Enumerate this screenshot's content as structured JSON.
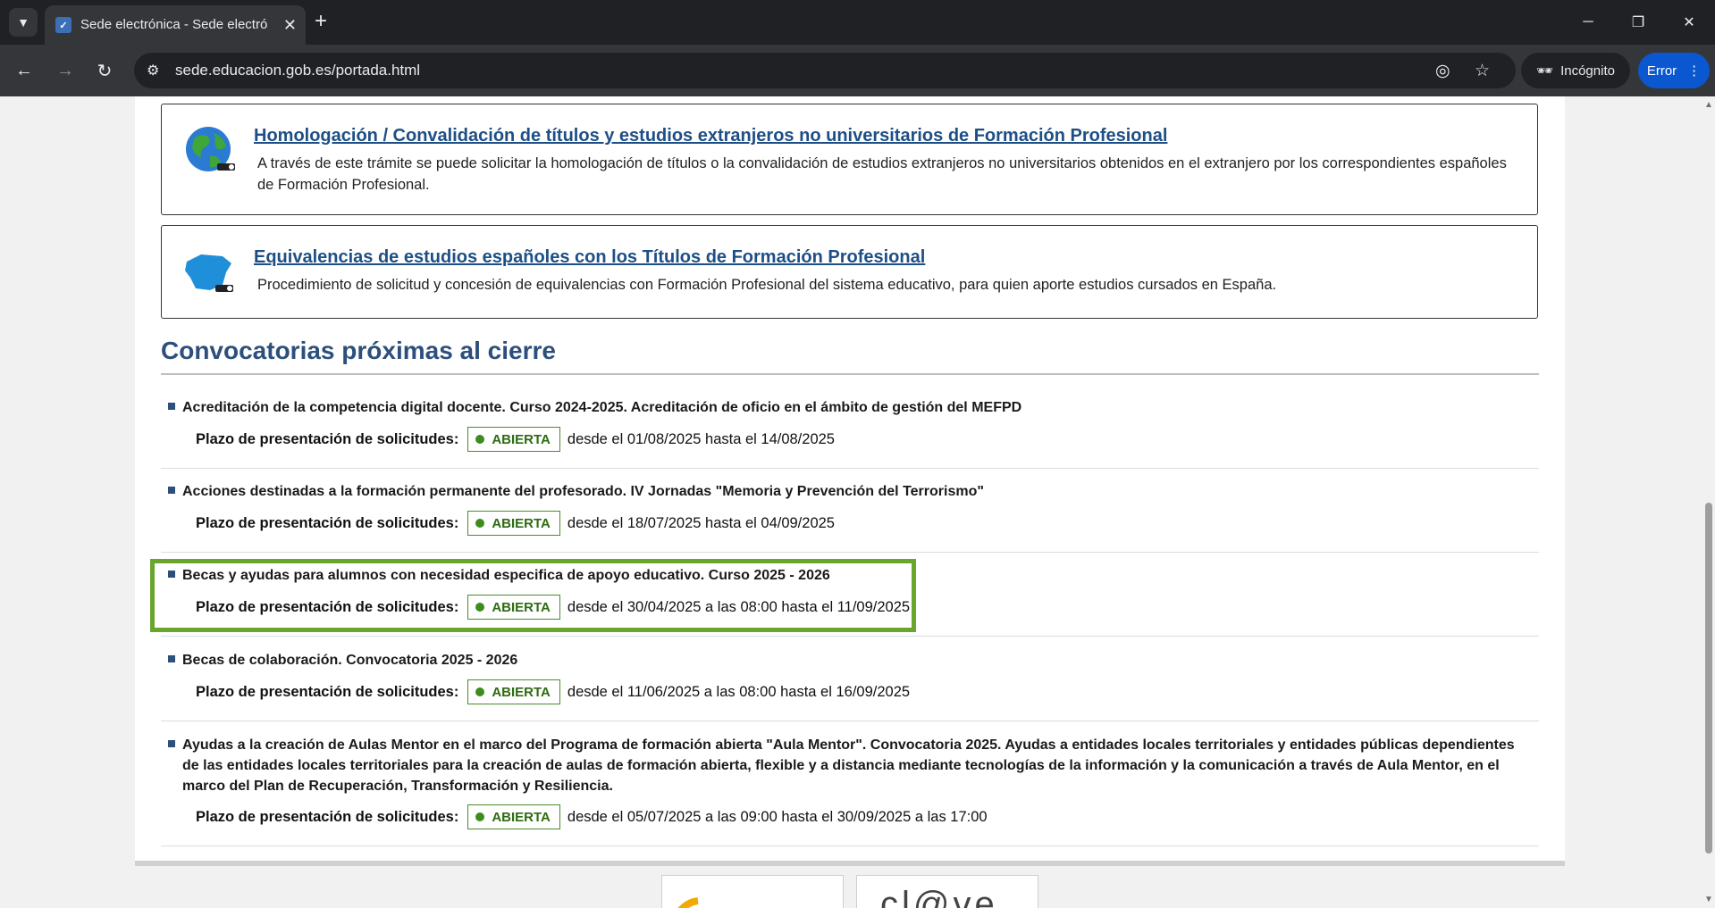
{
  "browser": {
    "tab_title": "Sede electrónica - Sede electrónica",
    "tab_close": "✕",
    "new_tab": "+",
    "url": "sede.educacion.gob.es/portada.html",
    "incognito_label": "Incógnito",
    "error_label": "Error"
  },
  "services": [
    {
      "title": "Homologación / Convalidación de títulos y estudios extranjeros no universitarios de Formación Profesional",
      "description": "A través de este trámite se puede solicitar la homologación de títulos o la convalidación de estudios extranjeros no universitarios obtenidos en el extranjero por los correspondientes españoles de Formación Profesional.",
      "icon": "globe-icon"
    },
    {
      "title": "Equivalencias de estudios españoles con los Títulos de Formación Profesional",
      "description": "Procedimiento de solicitud y concesión de equivalencias con Formación Profesional del sistema educativo, para quien aporte estudios cursados en España.",
      "icon": "spain-map-icon"
    }
  ],
  "section": {
    "title": "Convocatorias próximas al cierre"
  },
  "plazo_label": "Plazo de presentación de solicitudes:",
  "convocatorias": [
    {
      "title": "Acreditación de la competencia digital docente. Curso 2024-2025. Acreditación de oficio en el ámbito de gestión del MEFPD",
      "status": "ABIERTA",
      "dates": "desde el 01/08/2025 hasta el 14/08/2025"
    },
    {
      "title": "Acciones destinadas a la formación permanente del profesorado. IV Jornadas \"Memoria y Prevención del Terrorismo\"",
      "status": "ABIERTA",
      "dates": "desde el 18/07/2025 hasta el 04/09/2025"
    },
    {
      "title": "Becas y ayudas para alumnos con necesidad especifica de apoyo educativo. Curso 2025 - 2026",
      "status": "ABIERTA",
      "dates": "desde el 30/04/2025 a las 08:00 hasta el 11/09/2025"
    },
    {
      "title": "Becas de colaboración. Convocatoria 2025 - 2026",
      "status": "ABIERTA",
      "dates": "desde el 11/06/2025 a las 08:00 hasta el 16/09/2025"
    },
    {
      "title": "Ayudas a la creación de Aulas Mentor en el marco del Programa de formación abierta \"Aula Mentor\". Convocatoria 2025. Ayudas a entidades locales territoriales y entidades públicas dependientes de las entidades locales territoriales para la creación de aulas de formación abierta, flexible y a distancia mediante tecnologías de la información y la comunicación a través de Aula Mentor, en el marco del Plan de Recuperación, Transformación y Resiliencia.",
      "status": "ABIERTA",
      "dates": "desde el 05/07/2025 a las 09:00 hasta el 30/09/2025 a las 17:00"
    }
  ],
  "footer_logos": {
    "clave_text": "cl@ve"
  },
  "colors": {
    "link": "#1d4f86",
    "section_title": "#2c4f7c",
    "status_green": "#3c8c1e",
    "highlight": "#6aa62e"
  }
}
